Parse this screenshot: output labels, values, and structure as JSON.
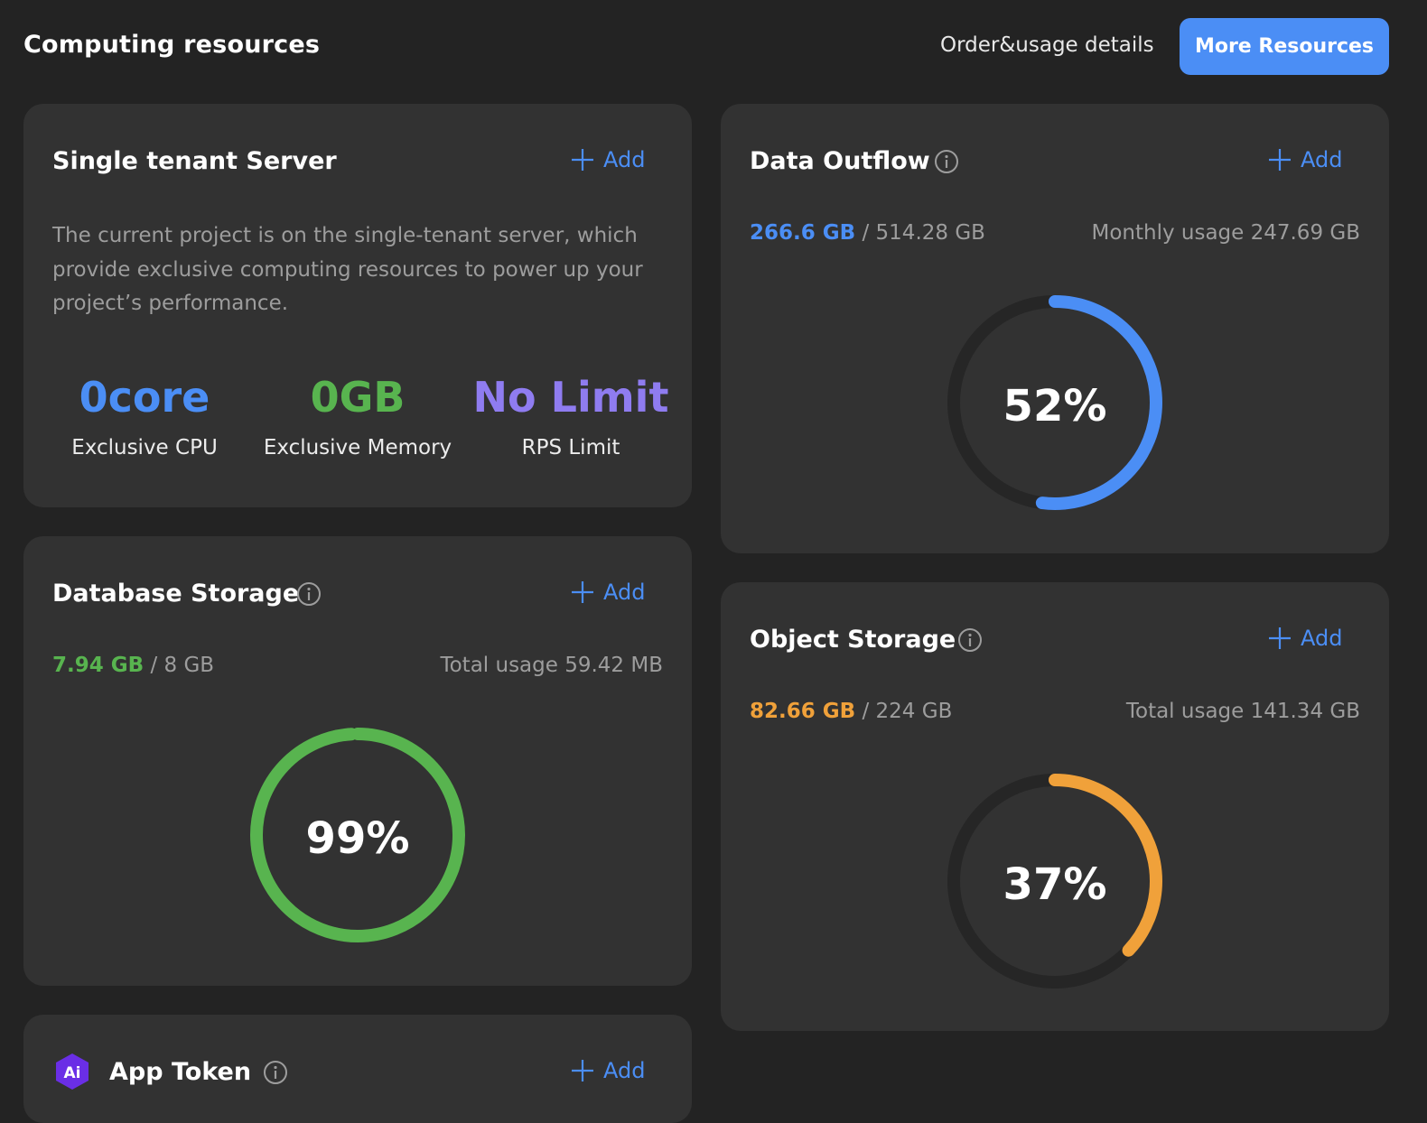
{
  "header": {
    "title": "Computing resources",
    "order_link": "Order&usage details",
    "more_button": "More Resources"
  },
  "single_tenant": {
    "title": "Single tenant Server",
    "add_label": "Add",
    "description": "The current project is on the single-tenant server, which provide exclusive computing resources to power up your project’s performance.",
    "metrics": [
      {
        "value": "0core",
        "label": "Exclusive CPU",
        "color": "#4b8ef5"
      },
      {
        "value": "0GB",
        "label": "Exclusive Memory",
        "color": "#58b44f"
      },
      {
        "value": "No Limit",
        "label": "RPS Limit",
        "color": "#8f7cf0"
      }
    ]
  },
  "database_storage": {
    "title": "Database Storage",
    "add_label": "Add",
    "used": "7.94 GB",
    "capacity": "/ 8 GB",
    "total_usage": "Total usage 59.42 MB",
    "percent_label": "99%",
    "percent": 0.99,
    "color": "#58b44f"
  },
  "data_outflow": {
    "title": "Data Outflow",
    "add_label": "Add",
    "used": "266.6 GB",
    "capacity": "/ 514.28 GB",
    "monthly_usage": "Monthly usage 247.69 GB",
    "percent_label": "52%",
    "percent": 0.52,
    "color": "#4b8ef5"
  },
  "object_storage": {
    "title": "Object Storage",
    "add_label": "Add",
    "used": "82.66 GB",
    "capacity": "/ 224 GB",
    "total_usage": "Total usage 141.34 GB",
    "percent_label": "37%",
    "percent": 0.37,
    "color": "#f0a13a"
  },
  "app_token": {
    "title": "App Token",
    "add_label": "Add",
    "logo_text": "Ai"
  },
  "colors": {
    "accent": "#4b8ef5",
    "track": "#262626"
  }
}
